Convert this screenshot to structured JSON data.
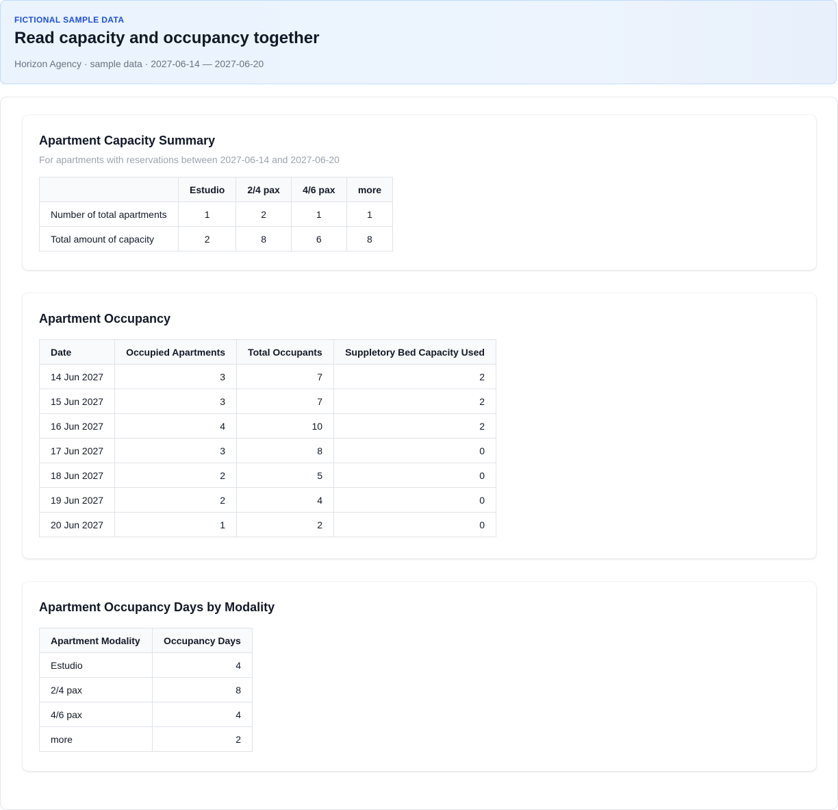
{
  "banner": {
    "eyebrow": "FICTIONAL SAMPLE DATA",
    "title": "Read capacity and occupancy together",
    "subtitle": "Horizon Agency · sample data · 2027-06-14 — 2027-06-20"
  },
  "capacity": {
    "title": "Apartment Capacity Summary",
    "note": "For apartments with reservations between 2027-06-14 and 2027-06-20",
    "columns": [
      "",
      "Estudio",
      "2/4 pax",
      "4/6 pax",
      "more"
    ],
    "rows": [
      [
        "Number of total apartments",
        "1",
        "2",
        "1",
        "1"
      ],
      [
        "Total amount of capacity",
        "2",
        "8",
        "6",
        "8"
      ]
    ]
  },
  "occupancy": {
    "title": "Apartment Occupancy",
    "columns": [
      "Date",
      "Occupied Apartments",
      "Total Occupants",
      "Suppletory Bed Capacity Used"
    ],
    "rows": [
      [
        "14 Jun 2027",
        "3",
        "7",
        "2"
      ],
      [
        "15 Jun 2027",
        "3",
        "7",
        "2"
      ],
      [
        "16 Jun 2027",
        "4",
        "10",
        "2"
      ],
      [
        "17 Jun 2027",
        "3",
        "8",
        "0"
      ],
      [
        "18 Jun 2027",
        "2",
        "5",
        "0"
      ],
      [
        "19 Jun 2027",
        "2",
        "4",
        "0"
      ],
      [
        "20 Jun 2027",
        "1",
        "2",
        "0"
      ]
    ]
  },
  "modality": {
    "title": "Apartment Occupancy Days by Modality",
    "columns": [
      "Apartment Modality",
      "Occupancy Days"
    ],
    "rows": [
      [
        "Estudio",
        "4"
      ],
      [
        "2/4 pax",
        "8"
      ],
      [
        "4/6 pax",
        "4"
      ],
      [
        "more",
        "2"
      ]
    ]
  }
}
